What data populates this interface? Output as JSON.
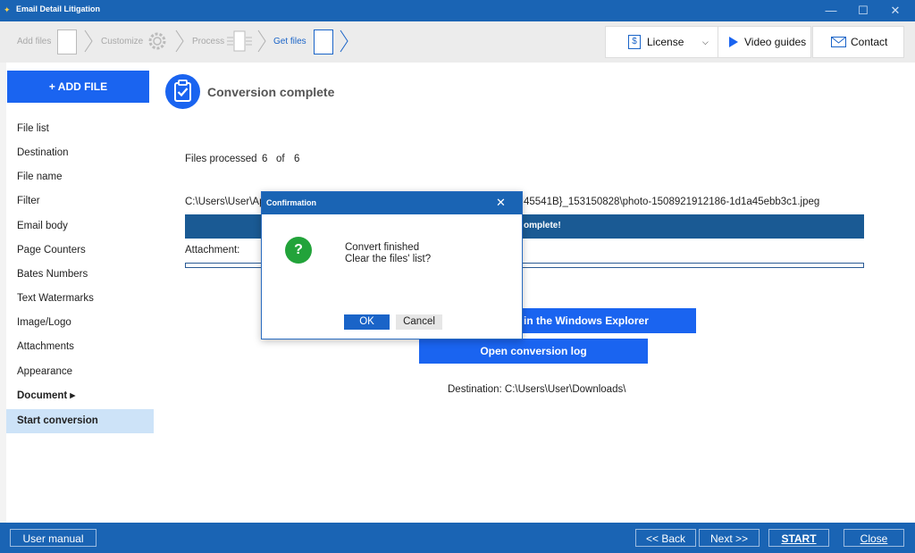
{
  "window": {
    "title": "Email Detail Litigation",
    "minimize_glyph": "—",
    "maximize_glyph": "☐",
    "close_glyph": "✕"
  },
  "wizard": {
    "steps": [
      {
        "label": "Add files"
      },
      {
        "label": "Customize"
      },
      {
        "label": "Process"
      },
      {
        "label": "Get files"
      }
    ],
    "license_label": "License",
    "video_label": "Video guides",
    "contact_label": "Contact"
  },
  "sidebar": {
    "add_file_label": "+ ADD FILE",
    "items": [
      {
        "label": "File list"
      },
      {
        "label": "Destination"
      },
      {
        "label": "File name"
      },
      {
        "label": "Filter"
      },
      {
        "label": "Email body"
      },
      {
        "label": "Page Counters"
      },
      {
        "label": "Bates Numbers"
      },
      {
        "label": "Text Watermarks"
      },
      {
        "label": "Image/Logo"
      },
      {
        "label": "Attachments"
      },
      {
        "label": "Appearance"
      },
      {
        "label": "Document ▸"
      },
      {
        "label": "Start conversion"
      }
    ]
  },
  "main": {
    "heading": "Conversion complete",
    "files_processed_label": "Files processed",
    "processed": "6",
    "of_label": "of",
    "total": "6",
    "path_left": "C:\\Users\\User\\Ap",
    "path_right": "45541B}_153150828\\photo-1508921912186-1d1a45ebb3c1.jpeg",
    "progress_text": "omplete!",
    "progress": 1.0,
    "attachment_label": "Attachment:",
    "explorer_button": "in the Windows Explorer",
    "log_button": "Open conversion log",
    "destination_text": "Destination: C:\\Users\\User\\Downloads\\"
  },
  "dialog": {
    "title": "Confirmation",
    "line1": "Convert finished",
    "line2": "Clear the files' list?",
    "ok_label": "OK",
    "cancel_label": "Cancel",
    "close_glyph": "✕",
    "icon_glyph": "?"
  },
  "footer": {
    "manual_label": "User manual",
    "back_label": "<< Back",
    "next_label": "Next >>",
    "start_label": "START",
    "close_label": "Close"
  },
  "colors": {
    "accent": "#1a64f0",
    "chrome": "#1a64b4",
    "selection": "#cde3f8",
    "success": "#22a33a"
  }
}
